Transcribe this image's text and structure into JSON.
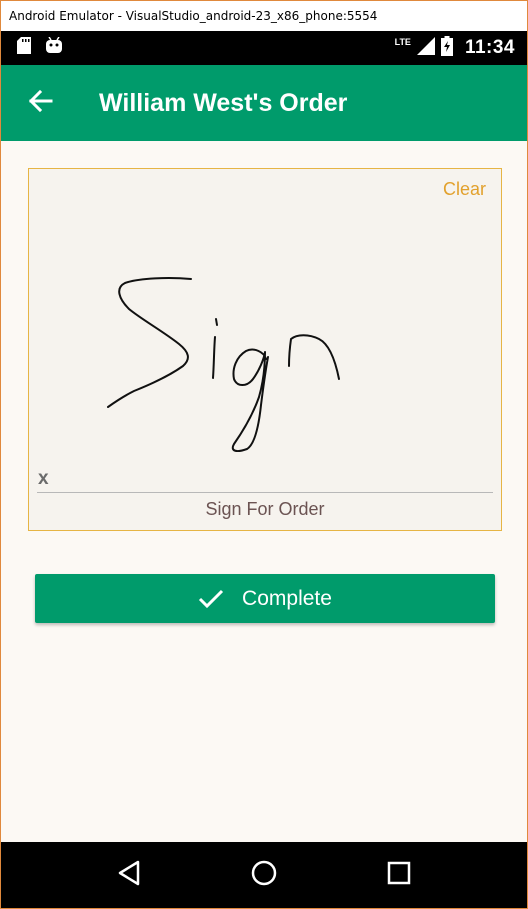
{
  "window": {
    "title": "Android Emulator - VisualStudio_android-23_x86_phone:5554"
  },
  "status_bar": {
    "left_icons": [
      "sd-card-icon",
      "android-debug-icon"
    ],
    "network_label": "LTE",
    "right_icons": [
      "signal-icon",
      "battery-icon"
    ],
    "time": "11:34"
  },
  "app_bar": {
    "back_icon": "arrow-back-icon",
    "title": "William West's Order",
    "color": "#009b6b"
  },
  "signature_pad": {
    "clear_label": "Clear",
    "x_marker": "x",
    "caption": "Sign For Order",
    "border_color": "#e6b544",
    "clear_color": "#e2a12d"
  },
  "complete_button": {
    "icon": "check-icon",
    "label": "Complete"
  },
  "nav_bar": {
    "buttons": [
      "back-triangle-icon",
      "home-circle-icon",
      "recents-square-icon"
    ]
  }
}
